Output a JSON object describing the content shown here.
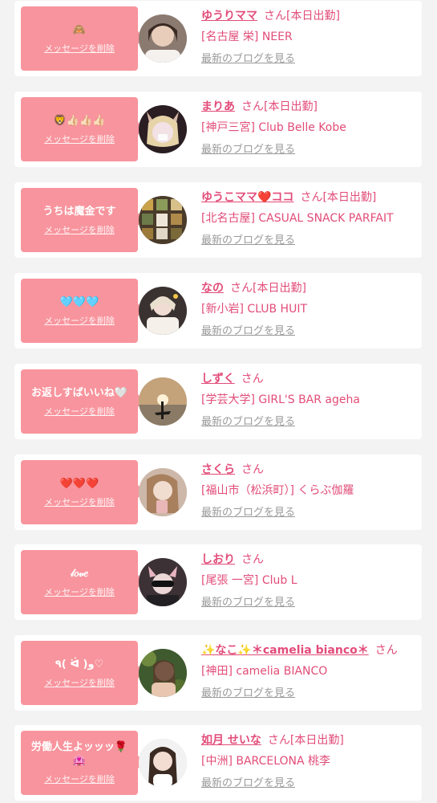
{
  "common": {
    "delete_label": "メッセージを削除",
    "blog_label": "最新のブログを見る",
    "san": "さん"
  },
  "colors": {
    "bubble": "#f8949d",
    "accent": "#e24c79",
    "muted": "#9a9a9a",
    "background": "#f3f3f3"
  },
  "messages": [
    {
      "message": "🙈",
      "name": "ゆうりママ",
      "status": "[本日出勤]",
      "shop": "[名古屋 栄] NEER"
    },
    {
      "message": "🦁👍🏻👍🏻👍🏻",
      "name": "まりあ",
      "status": "[本日出勤]",
      "shop": "[神戸三宮] Club Belle Kobe"
    },
    {
      "message": "うちは魔金です",
      "name": "ゆうこママ❤️ココ",
      "status": "[本日出勤]",
      "shop": "[北名古屋] CASUAL SNACK PARFAIT"
    },
    {
      "message": "🩵🩵🩵",
      "name": "なの",
      "status": "[本日出勤]",
      "shop": "[新小岩] CLUB HUIT"
    },
    {
      "message": "お返しすばいいね🤍",
      "name": "しずく",
      "status": "",
      "shop": "[学芸大学] GIRL'S BAR ageha"
    },
    {
      "message": "❤️❤️❤️",
      "name": "さくら",
      "status": "",
      "shop": "[福山市（松浜町）] くらぶ伽羅"
    },
    {
      "message": "𝓁𝑜𝓋𝑒",
      "name": "しおり",
      "status": "",
      "shop": "[尾張 一宮] Club L"
    },
    {
      "message": "٩( ᐛ )و♡",
      "name": "✨なこ✨＊camelia bianco＊",
      "status": "",
      "shop": "[神田] camelia BIANCO"
    },
    {
      "message": "労働人生よッッッ🌹🏩",
      "name": "如月 せいな",
      "status": "[本日出勤]",
      "shop": "[中洲] BARCELONA 桃李"
    }
  ]
}
